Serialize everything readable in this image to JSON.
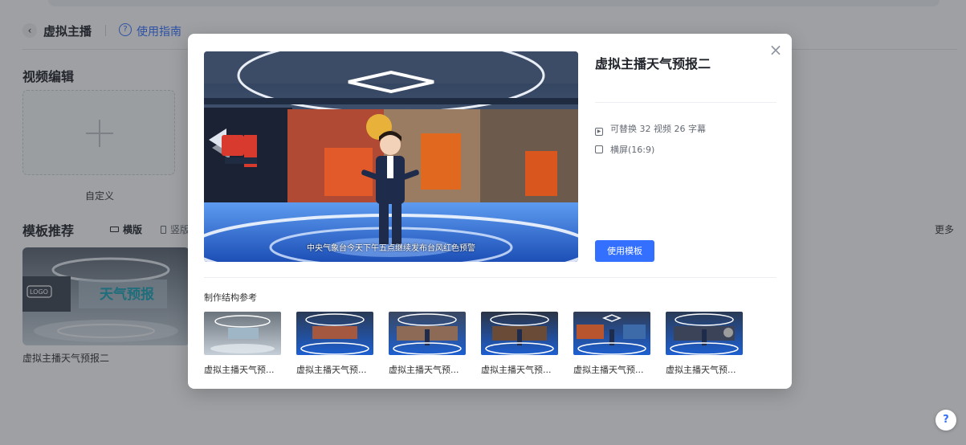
{
  "header": {
    "back_icon": "chevron-left-icon",
    "title": "虚拟主播",
    "guide_icon": "question-circle-icon",
    "guide_label": "使用指南"
  },
  "video_edit": {
    "title": "视频编辑",
    "custom_label": "自定义"
  },
  "templates": {
    "title": "模板推荐",
    "tabs": [
      "横版",
      "竖版"
    ],
    "active_tab": "横版",
    "more_label": "更多",
    "card_label": "虚拟主播天气预报二",
    "card_logo_text": "LOGO",
    "card_banner_text": "天气预报"
  },
  "modal": {
    "title": "虚拟主播天气预报二",
    "close_icon": "close-icon",
    "subtitle": "中央气象台今天下午五点继续发布台风红色预警",
    "replace_info": "可替换 32 视频 26 字幕",
    "ratio_info": "横屏(16:9)",
    "use_button": "使用模板",
    "structure_title": "制作结构参考",
    "thumb_labels": [
      "虚拟主播天气预...",
      "虚拟主播天气预...",
      "虚拟主播天气预...",
      "虚拟主播天气预...",
      "虚拟主播天气预...",
      "虚拟主播天气预..."
    ]
  },
  "help": {
    "label": "?"
  },
  "colors": {
    "accent": "#3370ff",
    "overlay": "rgba(40,44,52,0.45)",
    "studio_blue": "#1d5fd0"
  }
}
